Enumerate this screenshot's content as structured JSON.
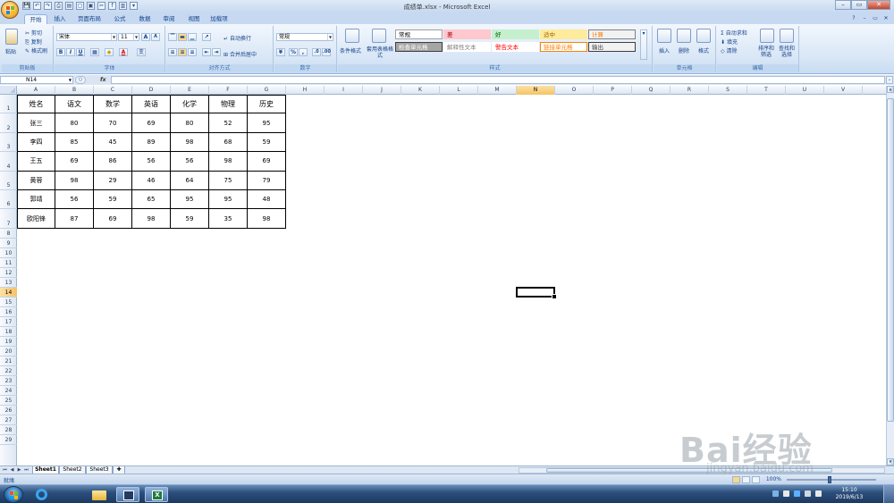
{
  "window": {
    "title": "成绩单.xlsx - Microsoft Excel",
    "controls": [
      "–",
      "▭",
      "✕"
    ]
  },
  "qat_icons": [
    "save-icon",
    "undo-icon",
    "redo-icon",
    "print-icon",
    "preview-icon",
    "new-icon",
    "open-icon",
    "cut-icon",
    "formula-icon",
    "chart-icon",
    "more-icon"
  ],
  "ribbon_tabs": [
    "开始",
    "插入",
    "页面布局",
    "公式",
    "数据",
    "审阅",
    "视图",
    "加载项"
  ],
  "active_tab": "开始",
  "clipboard": {
    "paste": "粘贴",
    "cut": "剪切",
    "copy": "复制",
    "format_painter": "格式刷",
    "label": "剪贴板"
  },
  "font": {
    "name": "宋体",
    "size": "11",
    "label": "字体",
    "grow": "A",
    "shrink": "A",
    "bold": "B",
    "italic": "I",
    "underline": "U",
    "font_color": "A",
    "wen": "变"
  },
  "alignment": {
    "wrap": "自动换行",
    "merge": "合并后居中",
    "label": "对齐方式"
  },
  "number": {
    "format": "常规",
    "percent": "%",
    "comma": ",",
    "label": "数字"
  },
  "styles": {
    "conditional": "条件格式",
    "table_format": "套用表格格式",
    "label": "样式",
    "cells": [
      {
        "text": "常规",
        "bg": "#ffffff",
        "fg": "#000000",
        "border": "#9f9f9f"
      },
      {
        "text": "差",
        "bg": "#ffc7ce",
        "fg": "#9c0006",
        "border": "#ffc7ce"
      },
      {
        "text": "好",
        "bg": "#c6efce",
        "fg": "#006100",
        "border": "#c6efce"
      },
      {
        "text": "适中",
        "bg": "#ffeb9c",
        "fg": "#9c6500",
        "border": "#ffeb9c"
      },
      {
        "text": "计算",
        "bg": "#f2f2f2",
        "fg": "#fa7d00",
        "border": "#7f7f7f"
      },
      {
        "text": "检查单元格",
        "bg": "#a5a5a5",
        "fg": "#ffffff",
        "border": "#3f3f3f"
      },
      {
        "text": "解释性文本",
        "bg": "#ffffff",
        "fg": "#7f7f7f",
        "border": "#ffffff"
      },
      {
        "text": "警告文本",
        "bg": "#ffffff",
        "fg": "#ff0000",
        "border": "#ffffff"
      },
      {
        "text": "链接单元格",
        "bg": "#ffffff",
        "fg": "#fa7d00",
        "border": "#ff8001"
      },
      {
        "text": "输出",
        "bg": "#f2f2f2",
        "fg": "#3f3f3f",
        "border": "#3f3f3f"
      }
    ]
  },
  "cells_group": {
    "insert": "插入",
    "delete": "删除",
    "format": "格式",
    "label": "单元格"
  },
  "editing": {
    "autosum": "自动求和",
    "fill": "填充",
    "clear": "清除",
    "sort": "排序和筛选",
    "find": "查找和选择",
    "label": "编辑"
  },
  "formula_bar": {
    "name_box": "N14",
    "fx": "fx",
    "value": ""
  },
  "columns": [
    "A",
    "B",
    "C",
    "D",
    "E",
    "F",
    "G",
    "H",
    "I",
    "J",
    "K",
    "L",
    "M",
    "N",
    "O",
    "P",
    "Q",
    "R",
    "S",
    "T",
    "U",
    "V"
  ],
  "selected_column": "N",
  "rows": [
    "1",
    "2",
    "3",
    "4",
    "5",
    "6",
    "7",
    "8",
    "9",
    "10",
    "11",
    "12",
    "13",
    "14",
    "15",
    "16",
    "17",
    "18",
    "19",
    "20",
    "21",
    "22",
    "23",
    "24",
    "25",
    "26",
    "27",
    "28",
    "29"
  ],
  "selected_row": "14",
  "table": {
    "header": [
      "姓名",
      "语文",
      "数学",
      "英语",
      "化学",
      "物理",
      "历史"
    ],
    "rows": [
      [
        "张三",
        "80",
        "70",
        "69",
        "80",
        "52",
        "95"
      ],
      [
        "李四",
        "85",
        "45",
        "89",
        "98",
        "68",
        "59"
      ],
      [
        "王五",
        "69",
        "86",
        "56",
        "56",
        "98",
        "69"
      ],
      [
        "黄蓉",
        "98",
        "29",
        "46",
        "64",
        "75",
        "79"
      ],
      [
        "郭靖",
        "56",
        "59",
        "65",
        "95",
        "95",
        "48"
      ],
      [
        "欧阳锋",
        "87",
        "69",
        "98",
        "59",
        "35",
        "98"
      ]
    ]
  },
  "sheets": [
    "Sheet1",
    "Sheet2",
    "Sheet3"
  ],
  "active_sheet": "Sheet1",
  "status": {
    "text": "就绪",
    "zoom": "100%"
  },
  "taskbar": {
    "time": "15:10",
    "date": "2019/6/13"
  },
  "watermark": {
    "brand": "Bai经验",
    "site": "jingyan.baidu.com"
  }
}
